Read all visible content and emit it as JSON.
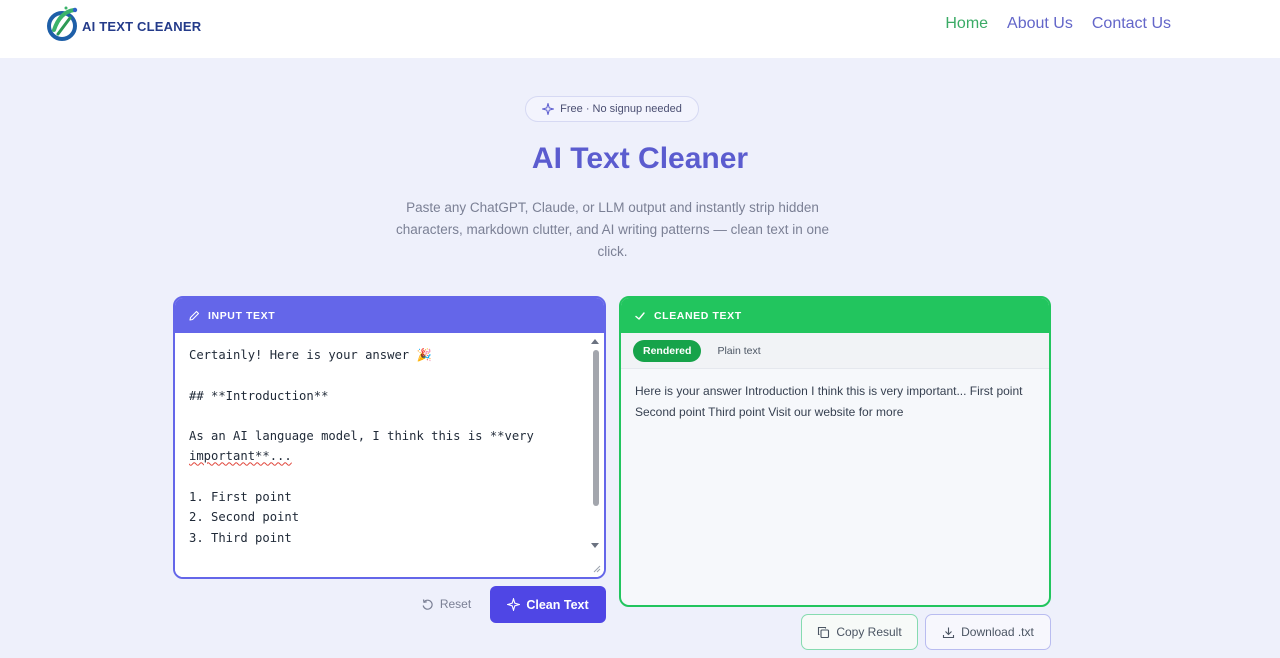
{
  "header": {
    "logo_text": "AI TEXT CLEANER",
    "nav": [
      {
        "label": "Home",
        "active": true
      },
      {
        "label": "About Us",
        "active": false
      },
      {
        "label": "Contact Us",
        "active": false
      }
    ]
  },
  "hero": {
    "badge": "Free · No signup needed",
    "title": "AI Text Cleaner",
    "subtitle": "Paste any ChatGPT, Claude, or LLM output and instantly strip hidden characters, markdown clutter, and AI writing patterns — clean text in one click."
  },
  "input_panel": {
    "header": "INPUT TEXT",
    "lines": [
      "Certainly! Here is your answer 🎉",
      "",
      "## **Introduction**",
      "",
      "As an AI language model, I think this is **very",
      "important**...",
      "",
      "1. First point",
      "2. Second point",
      "3. Third point"
    ]
  },
  "output_panel": {
    "header": "CLEANED TEXT",
    "tabs": [
      {
        "label": "Rendered",
        "active": true
      },
      {
        "label": "Plain text",
        "active": false
      }
    ],
    "result": "Here is your answer Introduction I think this is very important... First point Second point Third point Visit our website for more"
  },
  "buttons": {
    "reset": "Reset",
    "clean": "Clean Text",
    "copy": "Copy Result",
    "download": "Download .txt"
  },
  "colors": {
    "accent": "#6466e9",
    "success": "#22c55e",
    "background": "#eef0fb",
    "title": "#5b5ccf"
  }
}
